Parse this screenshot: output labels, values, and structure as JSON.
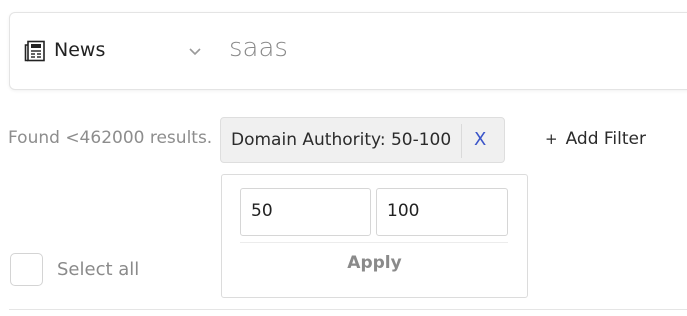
{
  "search": {
    "type_icon": "newspaper-icon",
    "type_label": "News",
    "chevron_icon": "chevron-down-icon",
    "query": "saas"
  },
  "results": {
    "found_text": "Found <462000 results."
  },
  "filter_chip": {
    "label": "Domain Authority: 50-100",
    "remove_label": "X"
  },
  "add_filter": {
    "icon": "plus",
    "label": "Add Filter",
    "plus": "+"
  },
  "popover": {
    "min_value": "50",
    "max_value": "100",
    "apply_label": "Apply"
  },
  "select_all": {
    "label": "Select all"
  },
  "colors": {
    "accent": "#3b55c9",
    "muted_text": "#8a8a8a",
    "chip_bg": "#f0f0f0"
  }
}
